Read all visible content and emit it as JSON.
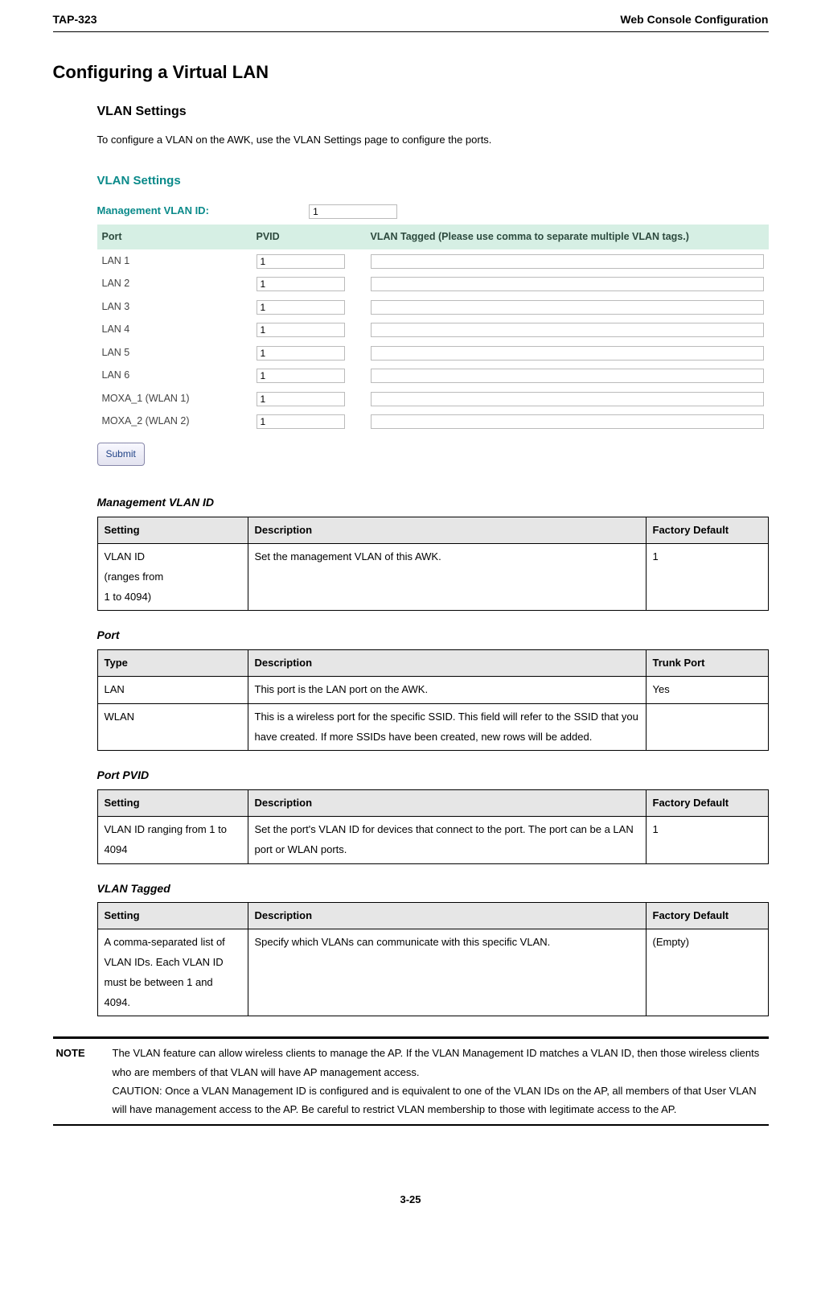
{
  "header": {
    "left": "TAP-323",
    "right": "Web Console Configuration"
  },
  "h1": "Configuring a Virtual LAN",
  "h2": "VLAN Settings",
  "intro": "To configure a VLAN on the AWK, use the VLAN Settings page to configure the ports.",
  "screenshot": {
    "title": "VLAN Settings",
    "mgmt_label": "Management VLAN ID:",
    "mgmt_value": "1",
    "cols": {
      "port": "Port",
      "pvid": "PVID",
      "tagged": "VLAN Tagged (Please use comma to separate multiple VLAN tags.)"
    },
    "rows": [
      {
        "port": "LAN 1",
        "pvid": "1",
        "tagged": ""
      },
      {
        "port": "LAN 2",
        "pvid": "1",
        "tagged": ""
      },
      {
        "port": "LAN 3",
        "pvid": "1",
        "tagged": ""
      },
      {
        "port": "LAN 4",
        "pvid": "1",
        "tagged": ""
      },
      {
        "port": "LAN 5",
        "pvid": "1",
        "tagged": ""
      },
      {
        "port": "LAN 6",
        "pvid": "1",
        "tagged": ""
      },
      {
        "port": "MOXA_1 (WLAN 1)",
        "pvid": "1",
        "tagged": ""
      },
      {
        "port": "MOXA_2 (WLAN 2)",
        "pvid": "1",
        "tagged": ""
      }
    ],
    "submit": "Submit"
  },
  "tables": {
    "mgmt": {
      "title": "Management VLAN ID",
      "head": [
        "Setting",
        "Description",
        "Factory Default"
      ],
      "rows": [
        [
          "VLAN ID\n(ranges from\n1 to 4094)",
          "Set the management VLAN of this AWK.",
          "1"
        ]
      ]
    },
    "port": {
      "title": "Port",
      "head": [
        "Type",
        "Description",
        "Trunk Port"
      ],
      "rows": [
        [
          "LAN",
          "This port is the LAN port on the AWK.",
          "Yes"
        ],
        [
          "WLAN",
          "This is a wireless port for the specific SSID. This field will refer to the SSID that you have created. If more SSIDs have been created, new rows will be added.",
          ""
        ]
      ]
    },
    "pvid": {
      "title": "Port PVID",
      "head": [
        "Setting",
        "Description",
        "Factory Default"
      ],
      "rows": [
        [
          "VLAN ID ranging from 1 to 4094",
          "Set the port's VLAN ID for devices that connect to the port. The port can be a LAN port or WLAN ports.",
          "1"
        ]
      ]
    },
    "tagged": {
      "title": "VLAN Tagged",
      "head": [
        "Setting",
        "Description",
        "Factory Default"
      ],
      "rows": [
        [
          "A comma-separated list of VLAN IDs. Each VLAN ID must be between 1 and 4094.",
          "Specify which VLANs can communicate with this specific VLAN.",
          "(Empty)"
        ]
      ]
    }
  },
  "note": {
    "label": "NOTE",
    "text1": "The VLAN feature can allow wireless clients to manage the AP. If the VLAN Management ID matches a VLAN ID, then those wireless clients who are members of that VLAN will have AP management access.",
    "text2": "CAUTION: Once a VLAN Management ID is configured and is equivalent to one of the VLAN IDs on the AP, all members of that User VLAN will have management access to the AP. Be careful to restrict VLAN membership to those with legitimate access to the AP."
  },
  "pagenum": "3-25"
}
